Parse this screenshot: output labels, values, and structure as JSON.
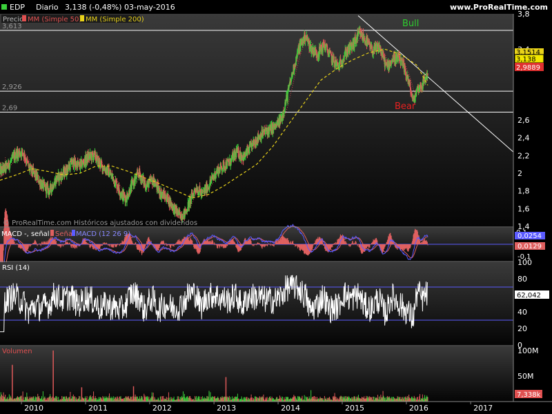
{
  "header": {
    "symbol": "EDP",
    "period": "Diario",
    "quote": "3,138 (-0,48%)",
    "date": "03-may-2016",
    "site": "www.ProRealTime.com"
  },
  "colors": {
    "up": "#3bd13b",
    "down": "#e05a5a",
    "ma50": "#e05050",
    "ma200": "#e8d21a",
    "macd": "#5b5bff",
    "signal": "#e06060",
    "hist": "#e06060",
    "rsi": "#ffffff",
    "volume_up": "#3bd13b",
    "volume_down": "#e05a5a",
    "bull": "#2ecc2e",
    "bear": "#e82020",
    "price_badge": "#f2e600",
    "ma_badge": "#e03030"
  },
  "chart_data": [
    {
      "type": "line",
      "panel": "price",
      "legend": {
        "precio": "Precio",
        "ma50": "MM (Simple 50)",
        "ma200": "MM (Simple 200)"
      },
      "copyright": "© ProRealTime.com  Históricos ajustados con dividendos",
      "y_range": [
        1.4,
        3.8
      ],
      "y_ticks": [
        {
          "v": 3.8,
          "label": "3,8"
        },
        {
          "v": 3.4,
          "label": "3,4"
        },
        {
          "v": 2.6,
          "label": "2,6"
        },
        {
          "v": 2.4,
          "label": "2,4"
        },
        {
          "v": 2.2,
          "label": "2,2"
        },
        {
          "v": 2.0,
          "label": "2"
        },
        {
          "v": 1.8,
          "label": "1,8"
        },
        {
          "v": 1.6,
          "label": "1,6"
        },
        {
          "v": 1.4,
          "label": "1,4"
        }
      ],
      "hlines": [
        {
          "v": 3.613,
          "label": "3,613"
        },
        {
          "v": 2.926,
          "label": "2,926"
        },
        {
          "v": 2.69,
          "label": "2,69"
        }
      ],
      "trendline": {
        "from": [
          "2015-04-01",
          3.78
        ],
        "to": [
          "2017-09-01",
          2.24
        ]
      },
      "annotations": [
        {
          "text": "Bull"
        },
        {
          "text": "Bear"
        }
      ],
      "badges": {
        "ma50": "3,1514",
        "price": "3,138",
        "ma200": "2,9889"
      },
      "close": [
        [
          "2009-09-01",
          2.02
        ],
        [
          "2009-10-15",
          2.08
        ],
        [
          "2009-12-01",
          2.22
        ],
        [
          "2010-01-10",
          2.24
        ],
        [
          "2010-02-15",
          2.05
        ],
        [
          "2010-03-20",
          1.98
        ],
        [
          "2010-05-01",
          1.86
        ],
        [
          "2010-06-10",
          1.8
        ],
        [
          "2010-07-20",
          1.94
        ],
        [
          "2010-09-01",
          2.0
        ],
        [
          "2010-10-15",
          2.12
        ],
        [
          "2010-12-01",
          2.08
        ],
        [
          "2011-01-15",
          2.18
        ],
        [
          "2011-02-20",
          2.2
        ],
        [
          "2011-04-01",
          2.08
        ],
        [
          "2011-05-10",
          2.02
        ],
        [
          "2011-06-20",
          1.9
        ],
        [
          "2011-07-25",
          1.76
        ],
        [
          "2011-08-20",
          1.72
        ],
        [
          "2011-09-25",
          1.88
        ],
        [
          "2011-11-01",
          2.0
        ],
        [
          "2011-12-10",
          1.86
        ],
        [
          "2012-01-20",
          1.92
        ],
        [
          "2012-03-01",
          1.78
        ],
        [
          "2012-04-10",
          1.72
        ],
        [
          "2012-05-20",
          1.6
        ],
        [
          "2012-06-20",
          1.52
        ],
        [
          "2012-07-20",
          1.55
        ],
        [
          "2012-08-20",
          1.7
        ],
        [
          "2012-09-20",
          1.84
        ],
        [
          "2012-10-25",
          1.76
        ],
        [
          "2012-12-01",
          1.86
        ],
        [
          "2013-01-15",
          2.02
        ],
        [
          "2013-02-20",
          2.08
        ],
        [
          "2013-04-01",
          2.12
        ],
        [
          "2013-05-10",
          2.24
        ],
        [
          "2013-06-20",
          2.18
        ],
        [
          "2013-08-01",
          2.3
        ],
        [
          "2013-09-15",
          2.42
        ],
        [
          "2013-11-01",
          2.48
        ],
        [
          "2013-12-15",
          2.52
        ],
        [
          "2014-01-20",
          2.62
        ],
        [
          "2014-02-25",
          2.9
        ],
        [
          "2014-04-01",
          3.2
        ],
        [
          "2014-05-01",
          3.42
        ],
        [
          "2014-06-05",
          3.55
        ],
        [
          "2014-07-10",
          3.4
        ],
        [
          "2014-08-15",
          3.35
        ],
        [
          "2014-09-20",
          3.45
        ],
        [
          "2014-11-01",
          3.3
        ],
        [
          "2014-12-10",
          3.2
        ],
        [
          "2015-01-20",
          3.36
        ],
        [
          "2015-03-01",
          3.44
        ],
        [
          "2015-04-10",
          3.58
        ],
        [
          "2015-05-15",
          3.5
        ],
        [
          "2015-06-20",
          3.38
        ],
        [
          "2015-08-01",
          3.42
        ],
        [
          "2015-09-10",
          3.2
        ],
        [
          "2015-10-20",
          3.3
        ],
        [
          "2015-11-25",
          3.28
        ],
        [
          "2016-01-05",
          3.1
        ],
        [
          "2016-02-10",
          2.8
        ],
        [
          "2016-03-01",
          2.95
        ],
        [
          "2016-04-01",
          3.0
        ],
        [
          "2016-05-03",
          3.138
        ]
      ],
      "ma200": [
        [
          "2009-09-01",
          1.92
        ],
        [
          "2009-12-01",
          1.98
        ],
        [
          "2010-03-01",
          2.05
        ],
        [
          "2010-06-01",
          2.02
        ],
        [
          "2010-09-01",
          1.98
        ],
        [
          "2010-12-01",
          2.0
        ],
        [
          "2011-03-01",
          2.08
        ],
        [
          "2011-06-01",
          2.08
        ],
        [
          "2011-09-01",
          2.02
        ],
        [
          "2011-12-01",
          1.95
        ],
        [
          "2012-03-01",
          1.88
        ],
        [
          "2012-06-01",
          1.8
        ],
        [
          "2012-09-01",
          1.72
        ],
        [
          "2012-12-01",
          1.76
        ],
        [
          "2013-03-01",
          1.86
        ],
        [
          "2013-06-01",
          1.98
        ],
        [
          "2013-09-01",
          2.1
        ],
        [
          "2013-12-01",
          2.3
        ],
        [
          "2014-03-01",
          2.55
        ],
        [
          "2014-06-01",
          2.8
        ],
        [
          "2014-09-01",
          3.05
        ],
        [
          "2014-12-01",
          3.18
        ],
        [
          "2015-03-01",
          3.28
        ],
        [
          "2015-06-01",
          3.36
        ],
        [
          "2015-09-01",
          3.4
        ],
        [
          "2015-12-01",
          3.34
        ],
        [
          "2016-03-01",
          3.22
        ],
        [
          "2016-05-03",
          2.99
        ]
      ]
    },
    {
      "type": "line",
      "panel": "macd",
      "legend": {
        "macd_title": "MACD",
        "signal": "Señal",
        "macd": "MACD (12 26 9)"
      },
      "labels": {
        "top": "0,1",
        "mid1": "0,0254",
        "mid2": "0,0129",
        "bottom": "-0,1"
      },
      "y_range": [
        -0.12,
        0.12
      ]
    },
    {
      "type": "line",
      "panel": "rsi",
      "legend": "RSI (14)",
      "y_range": [
        0,
        100
      ],
      "levels": [
        70,
        30
      ],
      "y_ticks": [
        {
          "v": 100,
          "label": "100"
        },
        {
          "v": 80,
          "label": "80"
        },
        {
          "v": 40,
          "label": "40"
        },
        {
          "v": 20,
          "label": "20"
        },
        {
          "v": 0,
          "label": "0"
        }
      ],
      "last": "62,042"
    },
    {
      "type": "bar",
      "panel": "volume",
      "legend": "Volumen",
      "y_ticks": [
        {
          "v": 100,
          "label": "100M"
        },
        {
          "v": 50,
          "label": "50M"
        }
      ],
      "last": "7,338k",
      "spikes": [
        [
          "2009-11-10",
          72
        ],
        [
          "2010-07-01",
          100
        ],
        [
          "2010-12-10",
          28
        ],
        [
          "2011-10-01",
          30
        ],
        [
          "2013-03-10",
          48
        ]
      ]
    }
  ],
  "x_axis": {
    "range": [
      "2009-09-01",
      "2017-09-01"
    ],
    "ticks": [
      {
        "date": "2010-01-01",
        "label": "2010"
      },
      {
        "date": "2011-01-01",
        "label": "2011"
      },
      {
        "date": "2012-01-01",
        "label": "2012"
      },
      {
        "date": "2013-01-01",
        "label": "2013"
      },
      {
        "date": "2014-01-01",
        "label": "2014"
      },
      {
        "date": "2015-01-01",
        "label": "2015"
      },
      {
        "date": "2016-01-01",
        "label": "2016"
      },
      {
        "date": "2017-01-01",
        "label": "2017"
      }
    ]
  }
}
